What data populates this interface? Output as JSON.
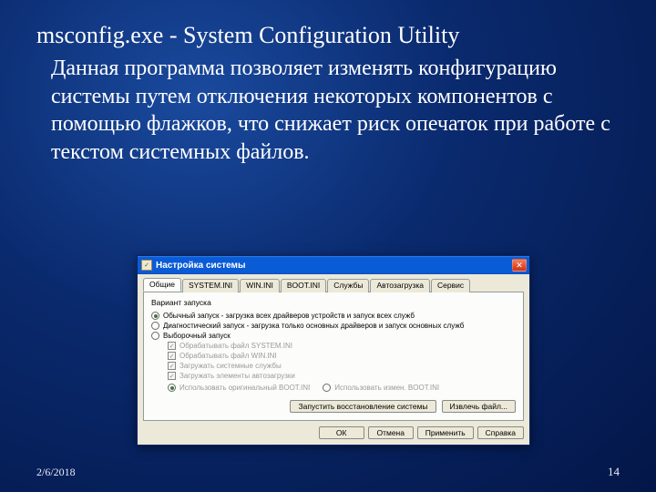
{
  "slide": {
    "title": "msconfig.exe - System Configuration Utility",
    "body": "Данная программа позволяет изменять конфигурацию системы путем отключения некоторых компонентов с помощью флажков, что снижает риск опечаток при работе с текстом системных файлов."
  },
  "dialog": {
    "title": "Настройка системы",
    "tabs": [
      "Общие",
      "SYSTEM.INI",
      "WIN.INI",
      "BOOT.INI",
      "Службы",
      "Автозагрузка",
      "Сервис"
    ],
    "active_tab": "Общие",
    "group_label": "Вариант запуска",
    "radios": [
      {
        "label": "Обычный запуск - загрузка всех драйверов устройств и запуск всех служб",
        "selected": true
      },
      {
        "label": "Диагностический запуск - загрузка только основных драйверов и запуск основных служб",
        "selected": false
      },
      {
        "label": "Выборочный запуск",
        "selected": false
      }
    ],
    "checks": [
      {
        "label": "Обрабатывать файл SYSTEM.INI",
        "checked": true
      },
      {
        "label": "Обрабатывать файл WIN.INI",
        "checked": true
      },
      {
        "label": "Загружать системные службы",
        "checked": true
      },
      {
        "label": "Загружать элементы автозагрузки",
        "checked": true
      }
    ],
    "boot_radios": [
      {
        "label": "Использовать оригинальный BOOT.INI",
        "selected": true
      },
      {
        "label": "Использовать измен. BOOT.INI",
        "selected": false
      }
    ],
    "panel_buttons": {
      "restore": "Запустить восстановление системы",
      "extract": "Извлечь файл..."
    },
    "buttons": {
      "ok": "ОК",
      "cancel": "Отмена",
      "apply": "Применить",
      "help": "Справка"
    }
  },
  "footer": {
    "date": "2/6/2018",
    "center": "",
    "page": "14"
  }
}
